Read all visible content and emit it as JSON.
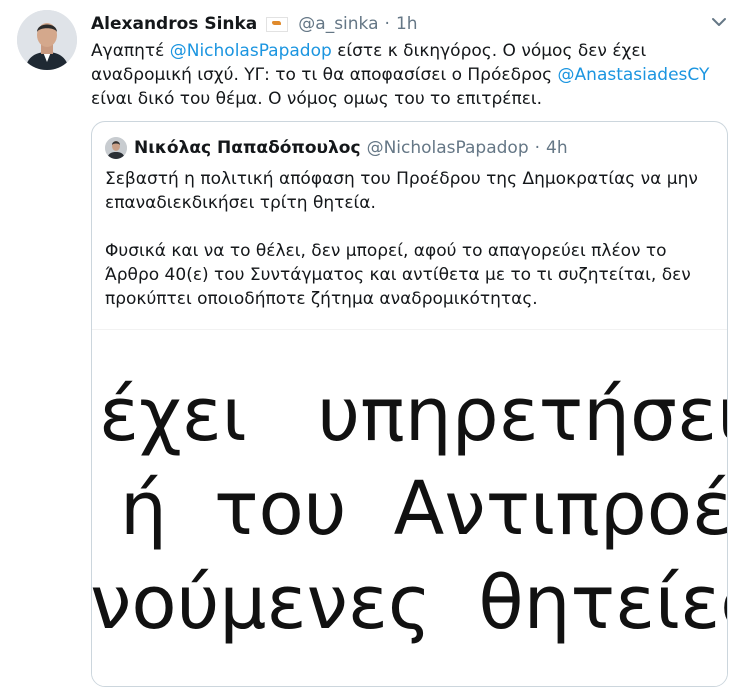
{
  "author": {
    "name": "Alexandros Sinka",
    "handle": "@a_sinka",
    "time": "1h",
    "flag_icon": "cyprus-flag-icon"
  },
  "tweet": {
    "text_1": "Αγαπητέ ",
    "mention_1": "@NicholasPapadop",
    "text_2": " είστε κ δικηγόρος. Ο νόμος δεν έχει αναδρομική ισχύ. ΥΓ: το τι θα αποφασίσει ο Πρόεδρος ",
    "mention_2": "@AnastasiadesCY",
    "text_3": " είναι δικό του θέμα. Ο νόμος ομως του το επιτρέπει."
  },
  "quoted": {
    "name": "Νικόλας Παπαδόπουλος",
    "handle": "@NicholasPapadop",
    "time": "4h",
    "paragraph_1": "Σεβαστή η πολιτική απόφαση του Προέδρου της Δημοκρατίας να μην επαναδιεκδικήσει τρίτη θητεία.",
    "paragraph_2": "Φυσικά και να το θέλει, δεν μπορεί, αφού το απαγορεύει πλέον το Άρθρο 40(ε) του Συντάγματος και αντίθετα με το τι συζητείται, δεν προκύπτει οποιοδήποτε ζήτημα αναδρομικότητας.",
    "image_lines": [
      "έχει   υπηρετήσει",
      "ή  του  Αντιπροέδρου",
      "νούμενες  θητείες"
    ]
  },
  "colors": {
    "link": "#1b95e0",
    "secondary_text": "#657786",
    "border": "#ccd6dd"
  }
}
